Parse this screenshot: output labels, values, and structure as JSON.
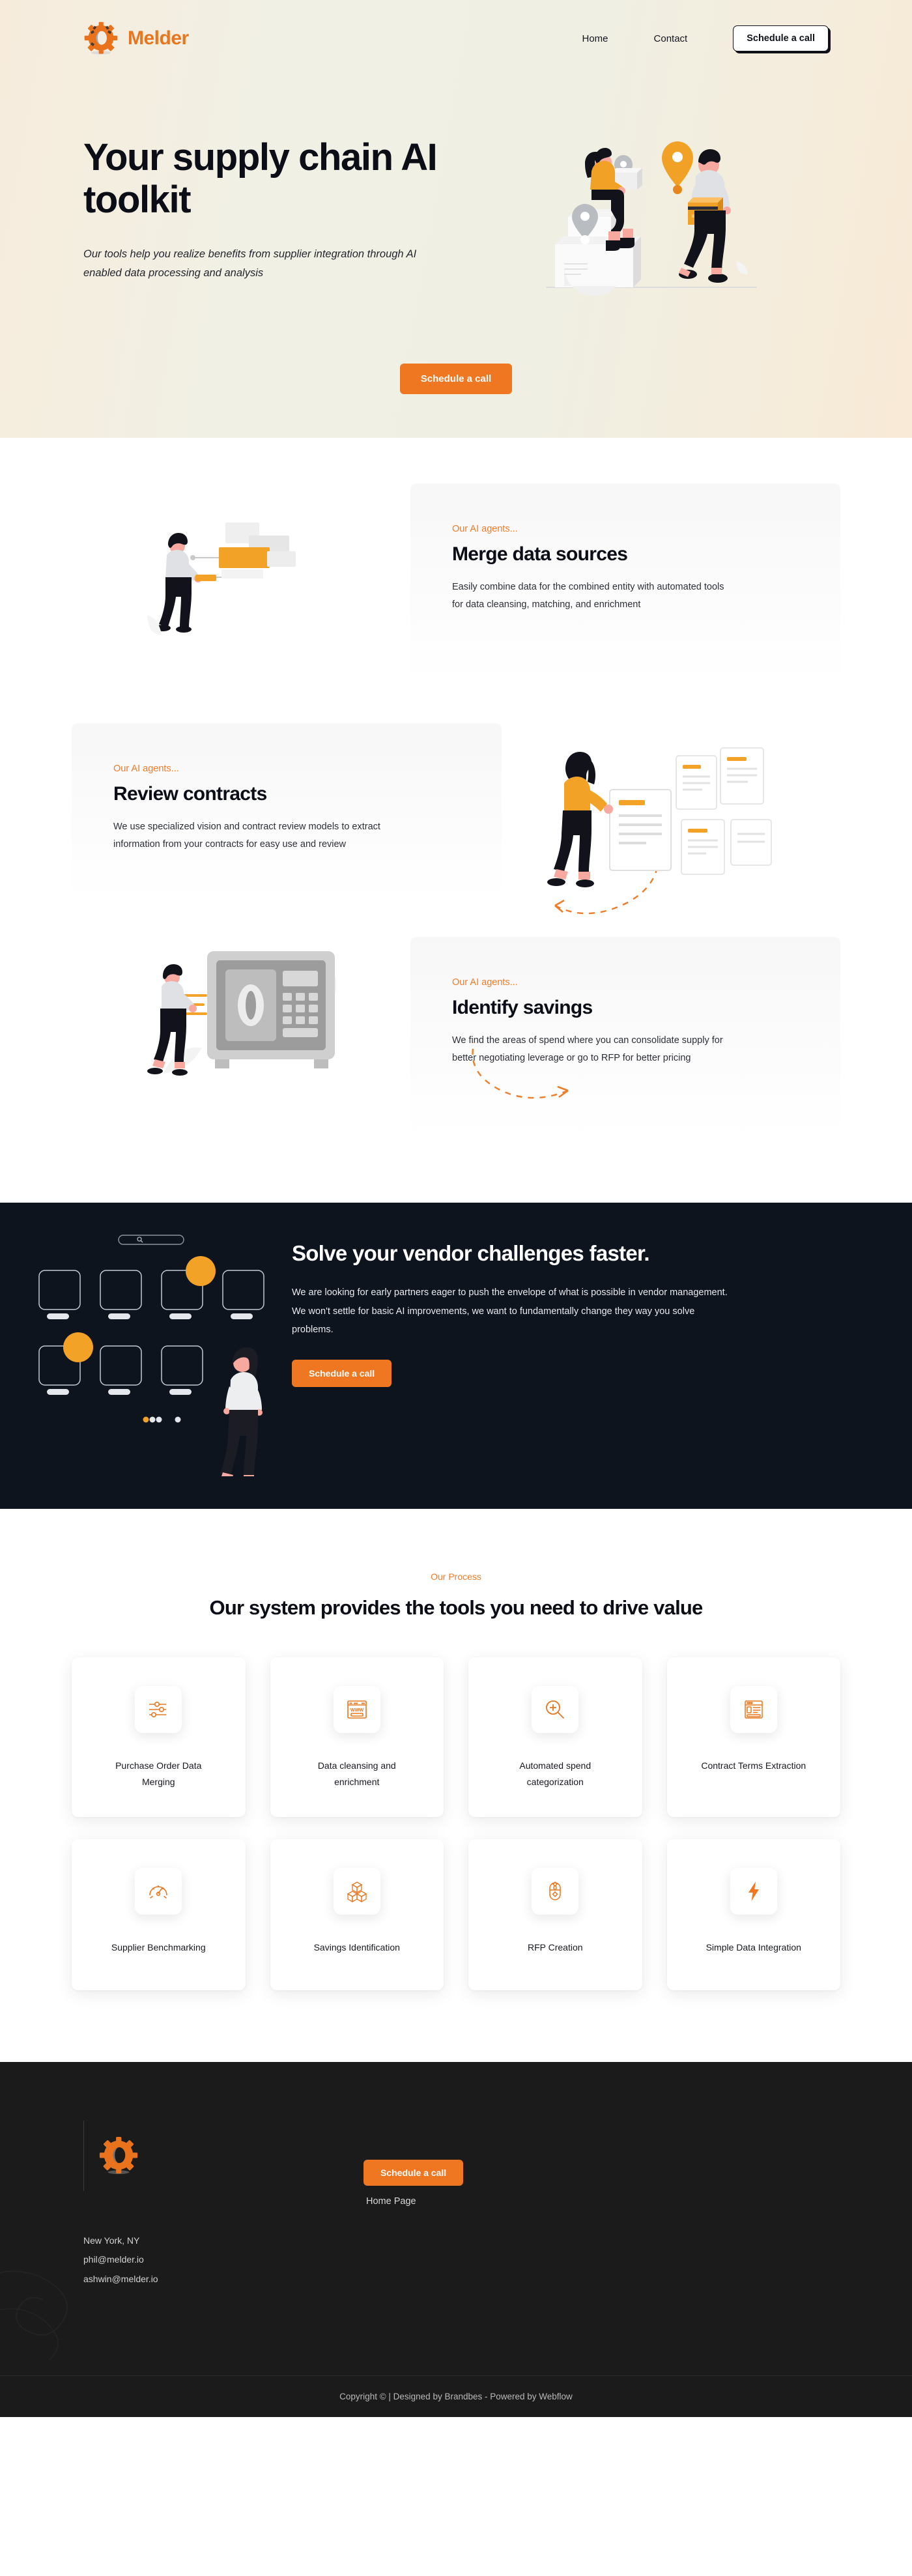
{
  "nav": {
    "brand": "Melder",
    "logo_icon": "gear-icon",
    "links": [
      {
        "label": "Home"
      },
      {
        "label": "Contact"
      }
    ],
    "cta": "Schedule a call"
  },
  "hero": {
    "title": "Your supply chain AI toolkit",
    "subtitle": "Our tools help you realize benefits from supplier integration through AI enabled data processing and analysis",
    "cta": "Schedule a call",
    "illustration": "delivery-people-illustration"
  },
  "features": [
    {
      "eyebrow": "Our AI agents...",
      "title": "Merge data sources",
      "body": "Easily combine data for the combined entity with automated tools for data cleansing, matching, and enrichment",
      "illustration": "person-connecting-data-blocks-illustration",
      "side": "right"
    },
    {
      "eyebrow": "Our AI agents...",
      "title": "Review contracts",
      "body": "We use specialized vision and contract review models to extract information from your contracts for easy use and review",
      "illustration": "woman-reviewing-documents-illustration",
      "side": "left"
    },
    {
      "eyebrow": "Our AI agents...",
      "title": "Identify savings",
      "body": "We find the areas of spend where you can consolidate supply for better negotiating leverage or go to RFP for better pricing",
      "illustration": "man-with-safe-illustration",
      "side": "right"
    }
  ],
  "dark_cta": {
    "title": "Solve your vendor challenges faster.",
    "body": "We are looking for early partners eager to push the envelope of what is possible in vendor management. We won't settle for basic AI improvements, we want to fundamentally change they way you solve problems.",
    "cta": "Schedule a call",
    "illustration": "vendor-grid-search-illustration"
  },
  "process": {
    "eyebrow": "Our Process",
    "title": "Our system provides the tools you need to drive value",
    "cards": [
      {
        "label": "Purchase Order Data Merging",
        "icon": "sliders-icon"
      },
      {
        "label": "Data cleansing and enrichment",
        "icon": "browser-www-icon"
      },
      {
        "label": "Automated spend categorization",
        "icon": "magnifier-plus-icon"
      },
      {
        "label": "Contract Terms Extraction",
        "icon": "document-layout-icon"
      },
      {
        "label": "Supplier Benchmarking",
        "icon": "speedometer-icon"
      },
      {
        "label": "Savings Identification",
        "icon": "stacked-cubes-icon"
      },
      {
        "label": "RFP Creation",
        "icon": "mouse-icon"
      },
      {
        "label": "Simple Data Integration",
        "icon": "lightning-bolt-icon"
      }
    ]
  },
  "footer": {
    "logo_icon": "gear-icon",
    "address": [
      "New York, NY",
      "phil@melder.io",
      "ashwin@melder.io"
    ],
    "cta": "Schedule a call",
    "home_link": "Home Page",
    "copyright": "Copyright © | Designed by Brandbes - Powered by Webflow"
  },
  "colors": {
    "accent": "#f07721",
    "dark": "#0e141e",
    "footer_dark": "#1b1b1b",
    "hero_bg": "#f1f0e4",
    "text": "#0b0d17"
  }
}
